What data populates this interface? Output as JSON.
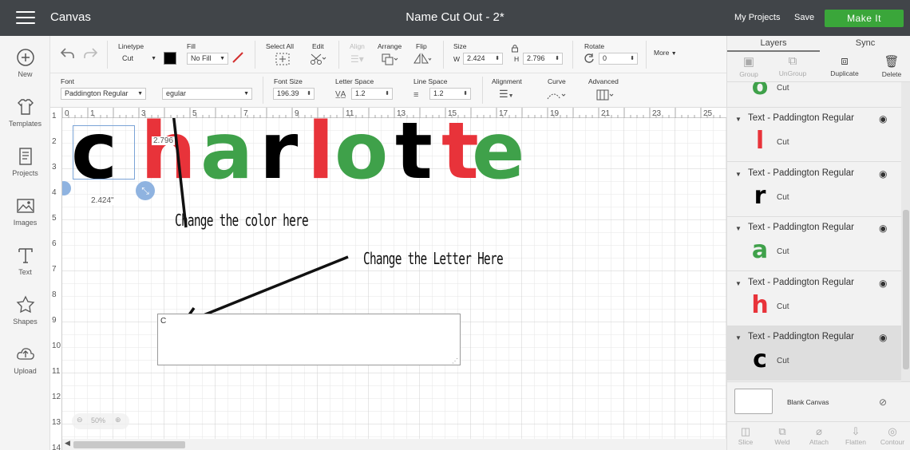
{
  "topbar": {
    "app_name": "Canvas",
    "title": "Name Cut Out - 2*",
    "my_projects": "My Projects",
    "save": "Save",
    "make_it": "Make It"
  },
  "left_tools": [
    {
      "label": "New",
      "icon": "plus-circle-icon"
    },
    {
      "label": "Templates",
      "icon": "shirt-icon"
    },
    {
      "label": "Projects",
      "icon": "book-icon"
    },
    {
      "label": "Images",
      "icon": "image-icon"
    },
    {
      "label": "Text",
      "icon": "text-t-icon"
    },
    {
      "label": "Shapes",
      "icon": "shapes-icon"
    },
    {
      "label": "Upload",
      "icon": "cloud-upload-icon"
    }
  ],
  "editbar": {
    "linetype_label": "Linetype",
    "linetype_value": "Cut",
    "fill_label": "Fill",
    "fill_value": "No Fill",
    "select_all": "Select All",
    "edit": "Edit",
    "align": "Align",
    "arrange": "Arrange",
    "flip": "Flip",
    "size_label": "Size",
    "w_label": "W",
    "w_value": "2.424",
    "h_label": "H",
    "h_value": "2.796",
    "rotate_label": "Rotate",
    "rotate_value": "0",
    "more": "More",
    "font_label": "Font",
    "font_value": "Paddington Regular",
    "style_value": "egular",
    "font_size_label": "Font Size",
    "font_size_value": "196.39",
    "letter_space_label": "Letter Space",
    "letter_space_value": "1.2",
    "line_space_label": "Line Space",
    "line_space_value": "1.2",
    "alignment_label": "Alignment",
    "curve_label": "Curve",
    "advanced_label": "Advanced"
  },
  "rulers": {
    "top": [
      "0",
      "1",
      "3",
      "5",
      "7",
      "9",
      "11",
      "13",
      "15",
      "17",
      "19",
      "21",
      "23",
      "25"
    ],
    "left": [
      "1",
      "2",
      "3",
      "4",
      "5",
      "6",
      "7",
      "8",
      "9",
      "10",
      "11",
      "12",
      "13",
      "14"
    ]
  },
  "canvas": {
    "name_letters": [
      {
        "ch": "c",
        "color": "#000000"
      },
      {
        "ch": "h",
        "color": "#e8333a"
      },
      {
        "ch": "a",
        "color": "#3fa14a"
      },
      {
        "ch": "r",
        "color": "#000000"
      },
      {
        "ch": "l",
        "color": "#e8333a"
      },
      {
        "ch": "o",
        "color": "#3fa14a"
      },
      {
        "ch": "t",
        "color": "#000000"
      },
      {
        "ch": "t",
        "color": "#e8333a"
      },
      {
        "ch": "e",
        "color": "#3fa14a"
      }
    ],
    "dim_height": "2.796",
    "dim_width": "2.424\"",
    "annotation_color": "Change the color here",
    "annotation_letter": "Change the Letter Here",
    "textbox_value": "C",
    "zoom": "50%"
  },
  "right_panel": {
    "tabs": [
      "Layers",
      "Sync"
    ],
    "tools": [
      {
        "label": "Group",
        "enabled": false
      },
      {
        "label": "UnGroup",
        "enabled": false
      },
      {
        "label": "Duplicate",
        "enabled": true
      },
      {
        "label": "Delete",
        "enabled": true
      }
    ],
    "partial_layer": {
      "glyph": "o",
      "color": "#3fa14a",
      "op": "Cut"
    },
    "layers": [
      {
        "name": "Text - Paddington Regular",
        "glyph": "l",
        "color": "#e8333a",
        "op": "Cut",
        "selected": false
      },
      {
        "name": "Text - Paddington Regular",
        "glyph": "r",
        "color": "#000000",
        "op": "Cut",
        "selected": false
      },
      {
        "name": "Text - Paddington Regular",
        "glyph": "a",
        "color": "#3fa14a",
        "op": "Cut",
        "selected": false
      },
      {
        "name": "Text - Paddington Regular",
        "glyph": "h",
        "color": "#e8333a",
        "op": "Cut",
        "selected": false
      },
      {
        "name": "Text - Paddington Regular",
        "glyph": "c",
        "color": "#000000",
        "op": "Cut",
        "selected": true
      }
    ],
    "blank_canvas": "Blank Canvas",
    "bottom_tools": [
      "Slice",
      "Weld",
      "Attach",
      "Flatten",
      "Contour"
    ]
  }
}
